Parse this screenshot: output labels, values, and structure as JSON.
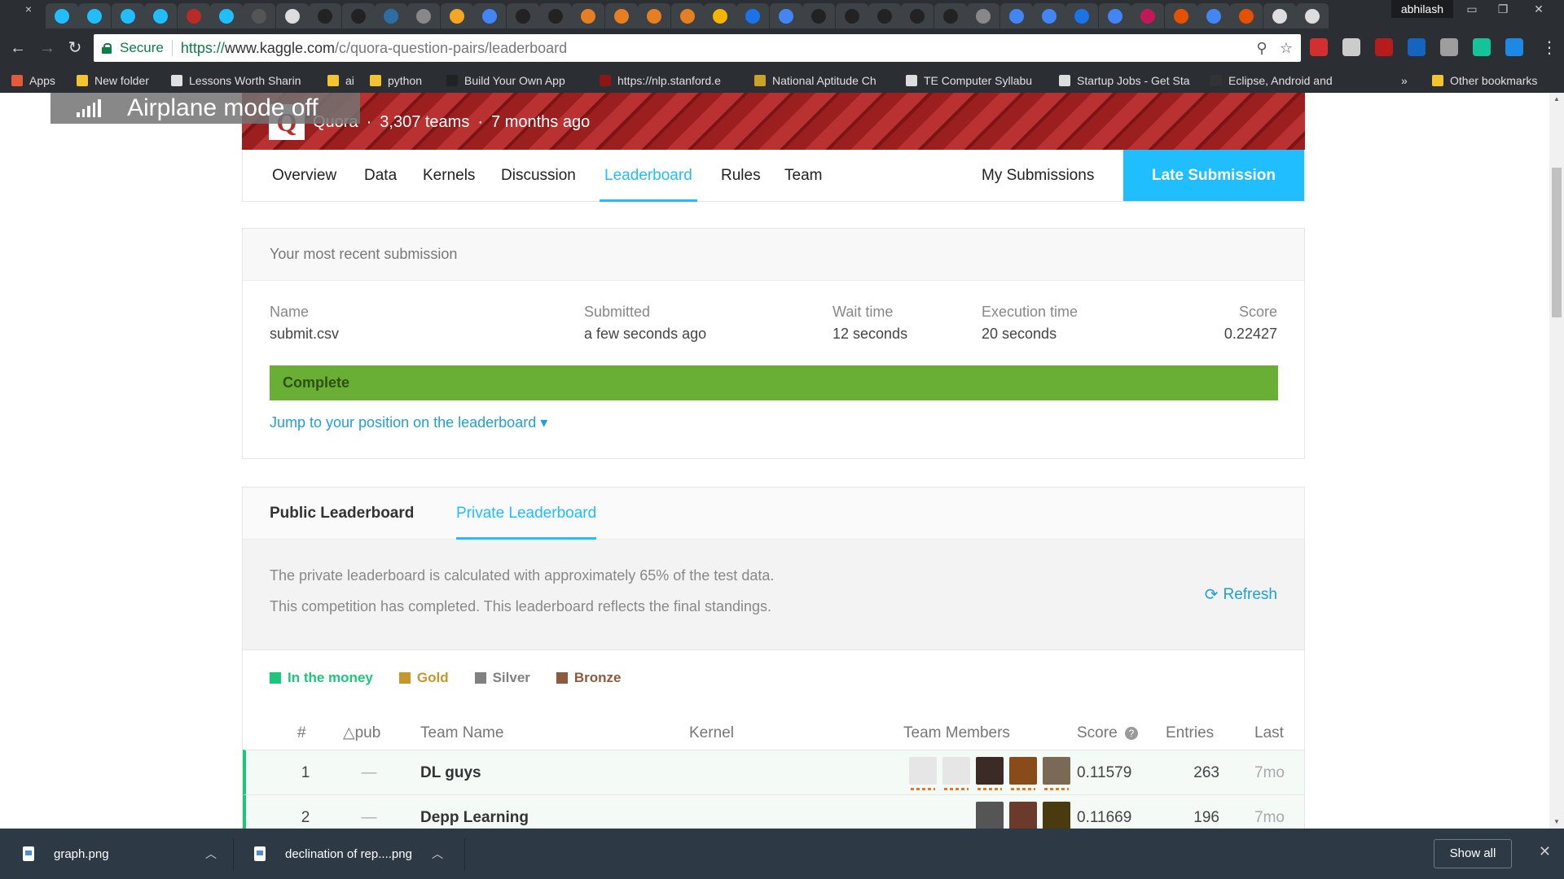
{
  "browser": {
    "profile_name": "abhilash",
    "close_tab": "×",
    "secure_label": "Secure",
    "url_scheme": "https://",
    "url_host": "www.kaggle.com",
    "url_path": "/c/quora-question-pairs/leaderboard",
    "bookmarks": [
      {
        "label": "Apps",
        "color": "#e25c3a"
      },
      {
        "label": "New folder",
        "color": "#f4c430"
      },
      {
        "label": "Lessons Worth Sharin",
        "color": "#e0e0e0"
      },
      {
        "label": "ai",
        "color": "#f4c430"
      },
      {
        "label": "python",
        "color": "#f4c430"
      },
      {
        "label": "Build Your Own App",
        "color": "#222222"
      },
      {
        "label": "https://nlp.stanford.e",
        "color": "#8c1515"
      },
      {
        "label": "National Aptitude Ch",
        "color": "#c9a227"
      },
      {
        "label": "TE Computer Syllabu",
        "color": "#dddddd"
      },
      {
        "label": "Startup Jobs - Get Sta",
        "color": "#dddddd"
      },
      {
        "label": "Eclipse, Android and",
        "color": "#333333"
      }
    ],
    "bookmarks_overflow": "»",
    "other_bookmarks": "Other bookmarks",
    "omnibox_icons": [
      "zoom-icon",
      "star-icon"
    ],
    "extension_colors": [
      "#d32f2f",
      "#cccccc",
      "#b71c1c",
      "#1565c0",
      "#9e9e9e",
      "#15c39a",
      "#1e88e5"
    ]
  },
  "overlay": {
    "airplane_text": "Airplane mode off"
  },
  "competition": {
    "host": "Quora",
    "teams": "3,307 teams",
    "age": "7 months ago",
    "separator": "·"
  },
  "nav": {
    "tabs": [
      "Overview",
      "Data",
      "Kernels",
      "Discussion",
      "Leaderboard",
      "Rules",
      "Team"
    ],
    "active_tab": "Leaderboard",
    "my_submissions": "My Submissions",
    "late_submission": "Late Submission"
  },
  "submission": {
    "header": "Your most recent submission",
    "columns": [
      {
        "label": "Name",
        "value": "submit.csv"
      },
      {
        "label": "Submitted",
        "value": "a few seconds ago"
      },
      {
        "label": "Wait time",
        "value": "12 seconds"
      },
      {
        "label": "Execution time",
        "value": "20 seconds"
      },
      {
        "label": "Score",
        "value": "0.22427"
      }
    ],
    "status": "Complete",
    "jump_link": "Jump to your position on the leaderboard ▾"
  },
  "leaderboard": {
    "tabs": [
      "Public Leaderboard",
      "Private Leaderboard"
    ],
    "active_tab": "Private Leaderboard",
    "info_line_1": "The private leaderboard is calculated with approximately 65% of the test data.",
    "info_line_2": "This competition has completed. This leaderboard reflects the final standings.",
    "refresh_label": "Refresh",
    "legend": [
      {
        "label": "In the money",
        "color": "#1dc67a"
      },
      {
        "label": "Gold",
        "color": "#c9962d"
      },
      {
        "label": "Silver",
        "color": "#808080"
      },
      {
        "label": "Bronze",
        "color": "#8c5a3c"
      }
    ],
    "columns": [
      "#",
      "△pub",
      "Team Name",
      "Kernel",
      "Team Members",
      "Score",
      "Entries",
      "Last"
    ],
    "score_help_icon": "?",
    "rows": [
      {
        "rank": "1",
        "delta": "—",
        "team": "DL guys",
        "kernel": "",
        "score": "0.11579",
        "entries": "263",
        "last": "7mo",
        "avatars": [
          "#e6e6e6",
          "#e6e6e6",
          "#3b2a25",
          "#8a4b1a",
          "#7a6a55"
        ]
      },
      {
        "rank": "2",
        "delta": "—",
        "team": "Depp Learning",
        "kernel": "",
        "score": "0.11669",
        "entries": "196",
        "last": "7mo",
        "avatars": [
          "#555555",
          "#6b3a2a",
          "#4a3a10"
        ]
      }
    ]
  },
  "downloads": {
    "items": [
      "graph.png",
      "declination of rep....png"
    ],
    "show_all": "Show all",
    "close": "✕"
  }
}
